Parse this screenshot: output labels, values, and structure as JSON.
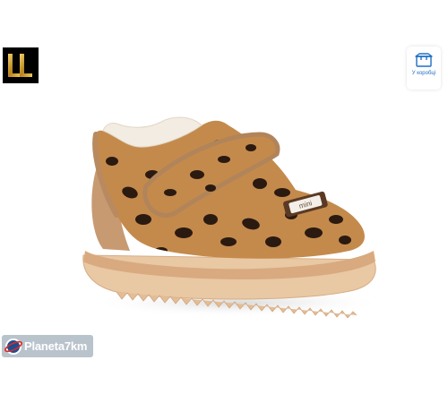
{
  "logo": {
    "text": "LL",
    "icon": "brand-logo"
  },
  "packaging_badge": {
    "label": "У коробці",
    "icon": "box-icon",
    "color": "#1f6fc5"
  },
  "product": {
    "description_icon": "leopard-print-baby-shoe",
    "tag_text": "mini"
  },
  "watermark": {
    "text": "Planeta7km",
    "icon": "planet-logo-icon"
  }
}
